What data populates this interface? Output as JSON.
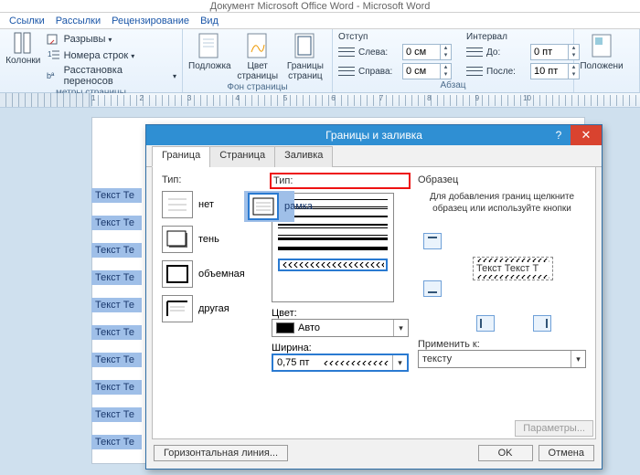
{
  "app_title": "Документ Microsoft Office Word - Microsoft Word",
  "tabs": {
    "t1": "Ссылки",
    "t2": "Рассылки",
    "t3": "Рецензирование",
    "t4": "Вид"
  },
  "ribbon": {
    "breaks": "Разрывы",
    "lineno": "Номера строк",
    "hyph": "Расстановка переносов",
    "columns": "Колонки",
    "group1": "метры страницы",
    "watermark": "Подложка",
    "pagecolor": "Цвет\nстраницы",
    "pageborders": "Границы\nстраниц",
    "group2": "Фон страницы",
    "indent_h": "Отступ",
    "indent_left": "Слева:",
    "indent_right": "Справа:",
    "indent_left_v": "0 см",
    "indent_right_v": "0 см",
    "spacing_h": "Интервал",
    "spacing_before": "До:",
    "spacing_after": "После:",
    "spacing_before_v": "0 пт",
    "spacing_after_v": "10 пт",
    "group3": "Абзац",
    "position": "Положени"
  },
  "ruler_left": "метры страницы",
  "doc_sel": "Текст Те",
  "dialog": {
    "title": "Границы и заливка",
    "help": "?",
    "close": "✕",
    "tabs": {
      "border": "Граница",
      "page": "Страница",
      "fill": "Заливка"
    },
    "type_label": "Тип:",
    "types": {
      "none": "нет",
      "box": "рамка",
      "shadow": "тень",
      "threeD": "объемная",
      "custom": "другая"
    },
    "style_label": "Тип:",
    "color_label": "Цвет:",
    "color_value": "Авто",
    "width_label": "Ширина:",
    "width_value": "0,75 пт",
    "preview_label": "Образец",
    "preview_hint": "Для добавления границ щелкните образец или используйте кнопки",
    "preview_text": "Текст Текст Т",
    "apply_label": "Применить к:",
    "apply_value": "тексту",
    "params": "Параметры...",
    "hline": "Горизонтальная линия...",
    "ok": "OK",
    "cancel": "Отмена"
  }
}
